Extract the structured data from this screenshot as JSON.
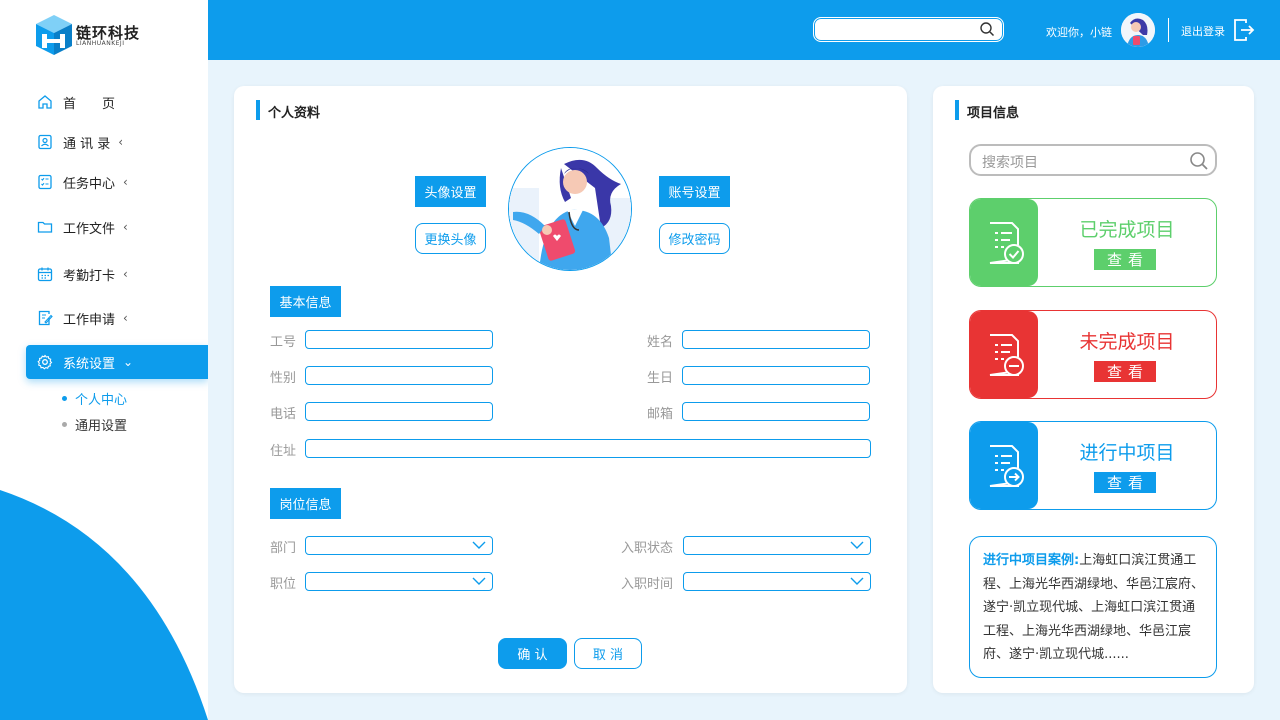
{
  "brand": {
    "name": "链环科技",
    "sub": "LIANHUANKEJI"
  },
  "header": {
    "welcome": "欢迎你，小链",
    "logout": "退出登录"
  },
  "sidebar": {
    "items": [
      {
        "label": "首　　页"
      },
      {
        "label": "通 讯 录"
      },
      {
        "label": "任务中心"
      },
      {
        "label": "工作文件"
      },
      {
        "label": "考勤打卡"
      },
      {
        "label": "工作申请"
      },
      {
        "label": "系统设置"
      }
    ],
    "sub_items": [
      {
        "label": "个人中心"
      },
      {
        "label": "通用设置"
      }
    ]
  },
  "profile": {
    "title": "个人资料",
    "avatar_settings": "头像设置",
    "change_avatar": "更换头像",
    "account_settings": "账号设置",
    "change_password": "修改密码",
    "basic_info": "基本信息",
    "job_info": "岗位信息",
    "fields": {
      "emp_id": "工号",
      "name": "姓名",
      "gender": "性别",
      "birthday": "生日",
      "phone": "电话",
      "email": "邮箱",
      "address": "住址",
      "department": "部门",
      "status": "入职状态",
      "position": "职位",
      "entry_date": "入职时间"
    },
    "confirm": "确 认",
    "cancel": "取 消"
  },
  "projects": {
    "title": "项目信息",
    "search_placeholder": "搜索项目",
    "cards": [
      {
        "title": "已完成项目",
        "action": "查看",
        "color": "#5dcf6c"
      },
      {
        "title": "未完成项目",
        "action": "查看",
        "color": "#e83434"
      },
      {
        "title": "进行中项目",
        "action": "查看",
        "color": "#0d9cec"
      }
    ],
    "case_title": "进行中项目案例:",
    "case_text": "上海虹口滨江贯通工程、上海光华西湖绿地、华邑江宸府、遂宁·凯立现代城、上海虹口滨江贯通工程、上海光华西湖绿地、华邑江宸府、遂宁·凯立现代城......"
  },
  "colors": {
    "accent": "#0d9cec",
    "green": "#5dcf6c",
    "red": "#e83434"
  }
}
